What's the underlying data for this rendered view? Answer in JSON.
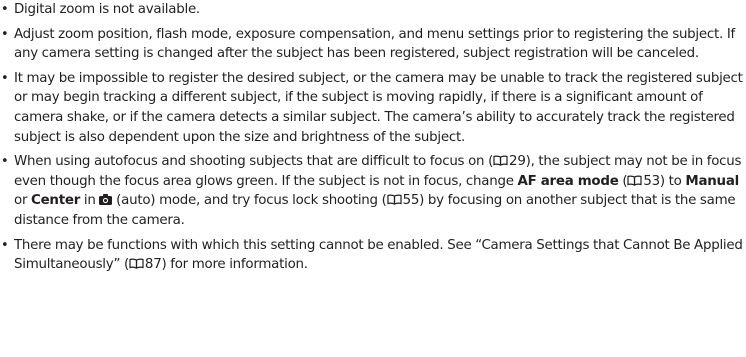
{
  "notes": [
    {
      "text": "Digital zoom is not available."
    },
    {
      "text": "Adjust zoom position, flash mode, exposure compensation, and menu settings prior to registering the subject. If any camera setting is changed after the subject has been registered, subject registration will be canceled."
    },
    {
      "text": "It may be impossible to register the desired subject, or the camera may be unable to track the registered subject or may begin tracking a different subject, if the subject is moving rapidly, if there is a significant amount of camera shake, or if the camera detects a similar subject. The camera’s ability to accurately track the registered subject is also dependent upon the size and brightness of the subject."
    },
    {
      "t1": "When using autofocus and shooting subjects that are difficult to focus on (",
      "p1": "29",
      "t2": "), the subject may not be in focus even though the focus area glows green. If the subject is not in focus, change ",
      "b1": "AF area mode",
      "t3": " (",
      "p2": "53",
      "t4": ") to ",
      "b2": "Manual",
      "t5": " or ",
      "b3": "Center",
      "t6": " in ",
      "t7": " (auto) mode, and try focus lock shooting (",
      "p3": "55",
      "t8": ") by focusing on another subject that is the same distance from the camera."
    },
    {
      "t1": "There may be functions with which this setting cannot be enabled. See “Camera Settings that Cannot Be Applied Simultaneously” (",
      "p1": "87",
      "t2": ") for more information."
    }
  ],
  "icons": {
    "page_reference": "book-reference-icon",
    "camera_mode": "camera-icon"
  }
}
